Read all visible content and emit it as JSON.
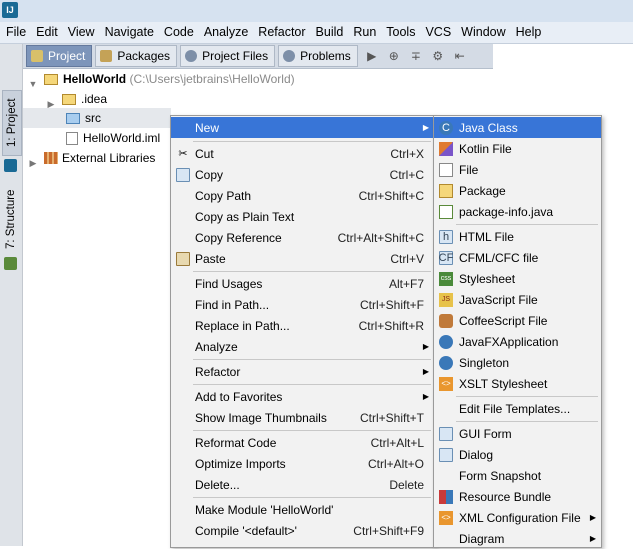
{
  "window": {
    "app_logo_text": "IJ"
  },
  "menubar": [
    "File",
    "Edit",
    "View",
    "Navigate",
    "Code",
    "Analyze",
    "Refactor",
    "Build",
    "Run",
    "Tools",
    "VCS",
    "Window",
    "Help"
  ],
  "left_strip": {
    "tab1": "1: Project",
    "tab2": "7: Structure"
  },
  "tool_tabs": [
    "Project",
    "Packages",
    "Project Files",
    "Problems"
  ],
  "tree": {
    "root_label": "HelloWorld",
    "root_path": "(C:\\Users\\jetbrains\\HelloWorld)",
    "idea": ".idea",
    "src": "src",
    "iml": "HelloWorld.iml",
    "ext": "External Libraries"
  },
  "context_menu": [
    {
      "label": "New",
      "shortcut": "",
      "submenu": true
    },
    {
      "label": "Cut",
      "shortcut": "Ctrl+X"
    },
    {
      "label": "Copy",
      "shortcut": "Ctrl+C"
    },
    {
      "label": "Copy Path",
      "shortcut": "Ctrl+Shift+C"
    },
    {
      "label": "Copy as Plain Text",
      "shortcut": ""
    },
    {
      "label": "Copy Reference",
      "shortcut": "Ctrl+Alt+Shift+C"
    },
    {
      "label": "Paste",
      "shortcut": "Ctrl+V"
    },
    {
      "label": "Find Usages",
      "shortcut": "Alt+F7"
    },
    {
      "label": "Find in Path...",
      "shortcut": "Ctrl+Shift+F"
    },
    {
      "label": "Replace in Path...",
      "shortcut": "Ctrl+Shift+R"
    },
    {
      "label": "Analyze",
      "shortcut": "",
      "submenu": true
    },
    {
      "label": "Refactor",
      "shortcut": "",
      "submenu": true
    },
    {
      "label": "Add to Favorites",
      "shortcut": "",
      "submenu": true
    },
    {
      "label": "Show Image Thumbnails",
      "shortcut": "Ctrl+Shift+T"
    },
    {
      "label": "Reformat Code",
      "shortcut": "Ctrl+Alt+L"
    },
    {
      "label": "Optimize Imports",
      "shortcut": "Ctrl+Alt+O"
    },
    {
      "label": "Delete...",
      "shortcut": "Delete"
    },
    {
      "label": "Make Module 'HelloWorld'",
      "shortcut": ""
    },
    {
      "label": "Compile '<default>'",
      "shortcut": "Ctrl+Shift+F9"
    }
  ],
  "submenu": [
    {
      "label": "Java Class",
      "icon": "java-class-icon"
    },
    {
      "label": "Kotlin File",
      "icon": "kotlin-file-icon"
    },
    {
      "label": "File",
      "icon": "file-icon"
    },
    {
      "label": "Package",
      "icon": "package-icon"
    },
    {
      "label": "package-info.java",
      "icon": "package-info-icon"
    },
    {
      "label": "HTML File",
      "icon": "html-file-icon"
    },
    {
      "label": "CFML/CFC file",
      "icon": "cfml-file-icon"
    },
    {
      "label": "Stylesheet",
      "icon": "stylesheet-icon"
    },
    {
      "label": "JavaScript File",
      "icon": "javascript-file-icon"
    },
    {
      "label": "CoffeeScript File",
      "icon": "coffeescript-file-icon"
    },
    {
      "label": "JavaFXApplication",
      "icon": "javafx-icon"
    },
    {
      "label": "Singleton",
      "icon": "singleton-icon"
    },
    {
      "label": "XSLT Stylesheet",
      "icon": "xslt-icon"
    },
    {
      "label": "Edit File Templates...",
      "icon": ""
    },
    {
      "label": "GUI Form",
      "icon": "gui-form-icon"
    },
    {
      "label": "Dialog",
      "icon": "dialog-icon"
    },
    {
      "label": "Form Snapshot",
      "icon": ""
    },
    {
      "label": "Resource Bundle",
      "icon": "resource-bundle-icon"
    },
    {
      "label": "XML Configuration File",
      "icon": "xml-config-icon",
      "submenu": true
    },
    {
      "label": "Diagram",
      "icon": "",
      "submenu": true
    }
  ],
  "colors": {
    "highlight": "#3875d7",
    "menu_bg": "#f2f2f2",
    "active_tab": "#7d95ba"
  }
}
